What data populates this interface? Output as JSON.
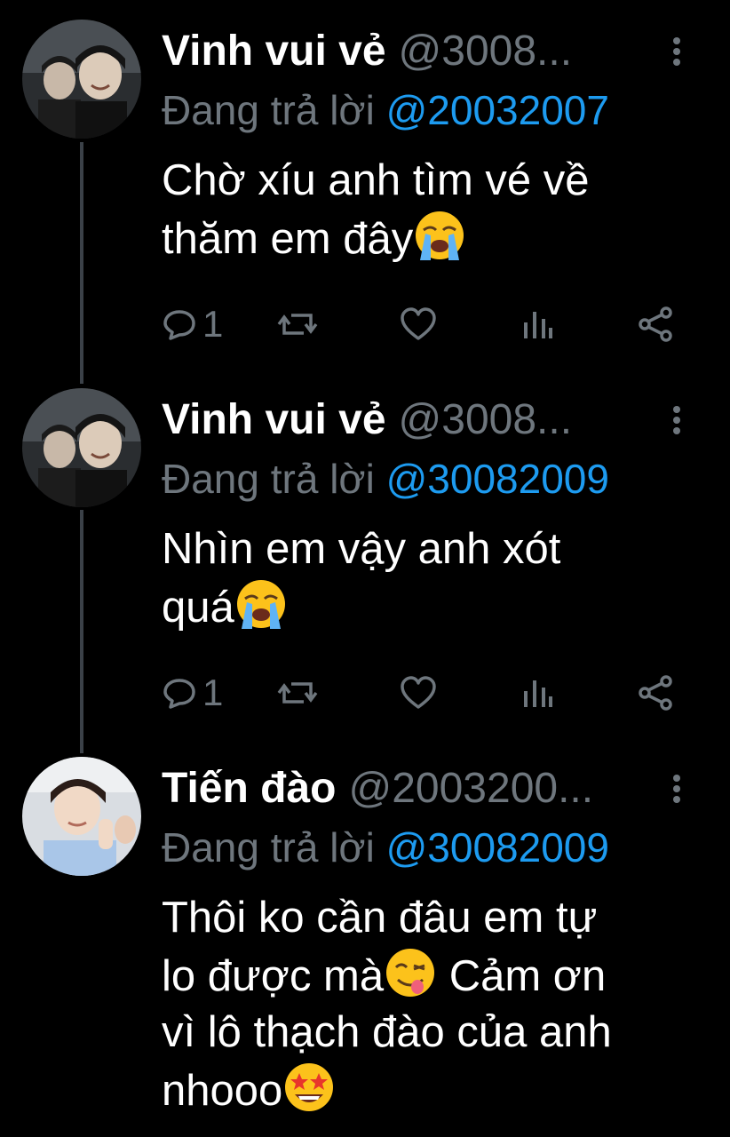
{
  "colors": {
    "background": "#000000",
    "name": "#ffffff",
    "muted": "#6e767d",
    "link": "#1d9bf0",
    "thread_line": "#3b4148"
  },
  "tweets": [
    {
      "name": "Vinh vui vẻ",
      "handle": "@3008...",
      "reply_prefix": "Đang trả lời",
      "reply_to": "@20032007",
      "text_lines": [
        "Chờ xíu anh tìm vé về",
        "thăm em đây"
      ],
      "emoji": "loudly-crying-face",
      "reply_count": "1"
    },
    {
      "name": "Vinh vui vẻ",
      "handle": "@3008...",
      "reply_prefix": "Đang trả lời",
      "reply_to": "@30082009",
      "text_lines": [
        "Nhìn em vậy anh xót",
        "quá"
      ],
      "emoji": "loudly-crying-face",
      "reply_count": "1"
    },
    {
      "name": "Tiến đào",
      "handle": "@2003200...",
      "reply_prefix": "Đang trả lời",
      "reply_to": "@30082009",
      "text_lines": [
        "Thôi ko cần đâu em tự",
        "lo được mà",
        " Cảm ơn",
        "vì lô thạch đào của anh",
        "nhooo"
      ],
      "emoji": "face-savoring-food, star-struck",
      "reply_count": ""
    }
  ]
}
